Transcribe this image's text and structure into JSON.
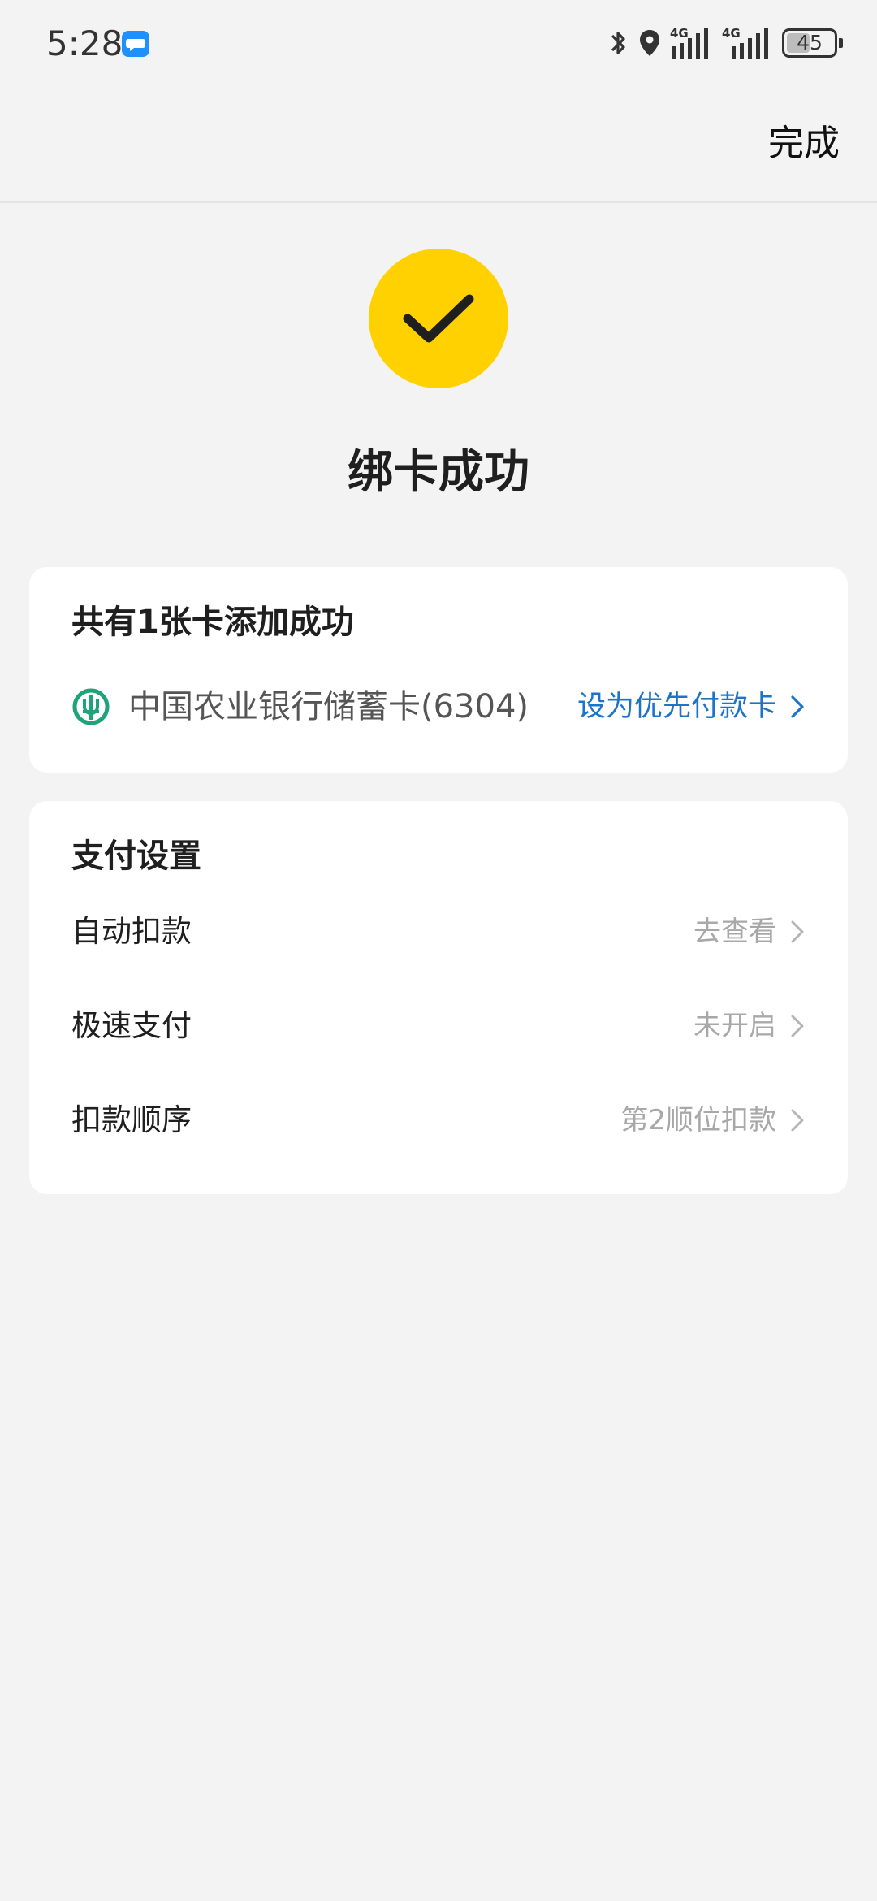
{
  "status_bar": {
    "time": "5:28",
    "network_1": "4G",
    "network_2": "4G",
    "battery": "45",
    "icons": [
      "message-icon",
      "bluetooth-icon",
      "location-icon",
      "signal-icon",
      "battery-icon"
    ]
  },
  "header": {
    "done_label": "完成"
  },
  "result": {
    "title": "绑卡成功",
    "icon": "checkmark-icon",
    "accent_color": "#FFD100"
  },
  "cards_section": {
    "title": "共有1张卡添加成功",
    "card": {
      "bank_name": "中国农业银行储蓄卡(6304)",
      "action_label": "设为优先付款卡",
      "bank_logo_color": "#1FA37A",
      "action_color": "#1C74C9"
    }
  },
  "payment_settings": {
    "title": "支付设置",
    "items": [
      {
        "label": "自动扣款",
        "value": "去查看"
      },
      {
        "label": "极速支付",
        "value": "未开启"
      },
      {
        "label": "扣款顺序",
        "value": "第2顺位扣款"
      }
    ]
  }
}
